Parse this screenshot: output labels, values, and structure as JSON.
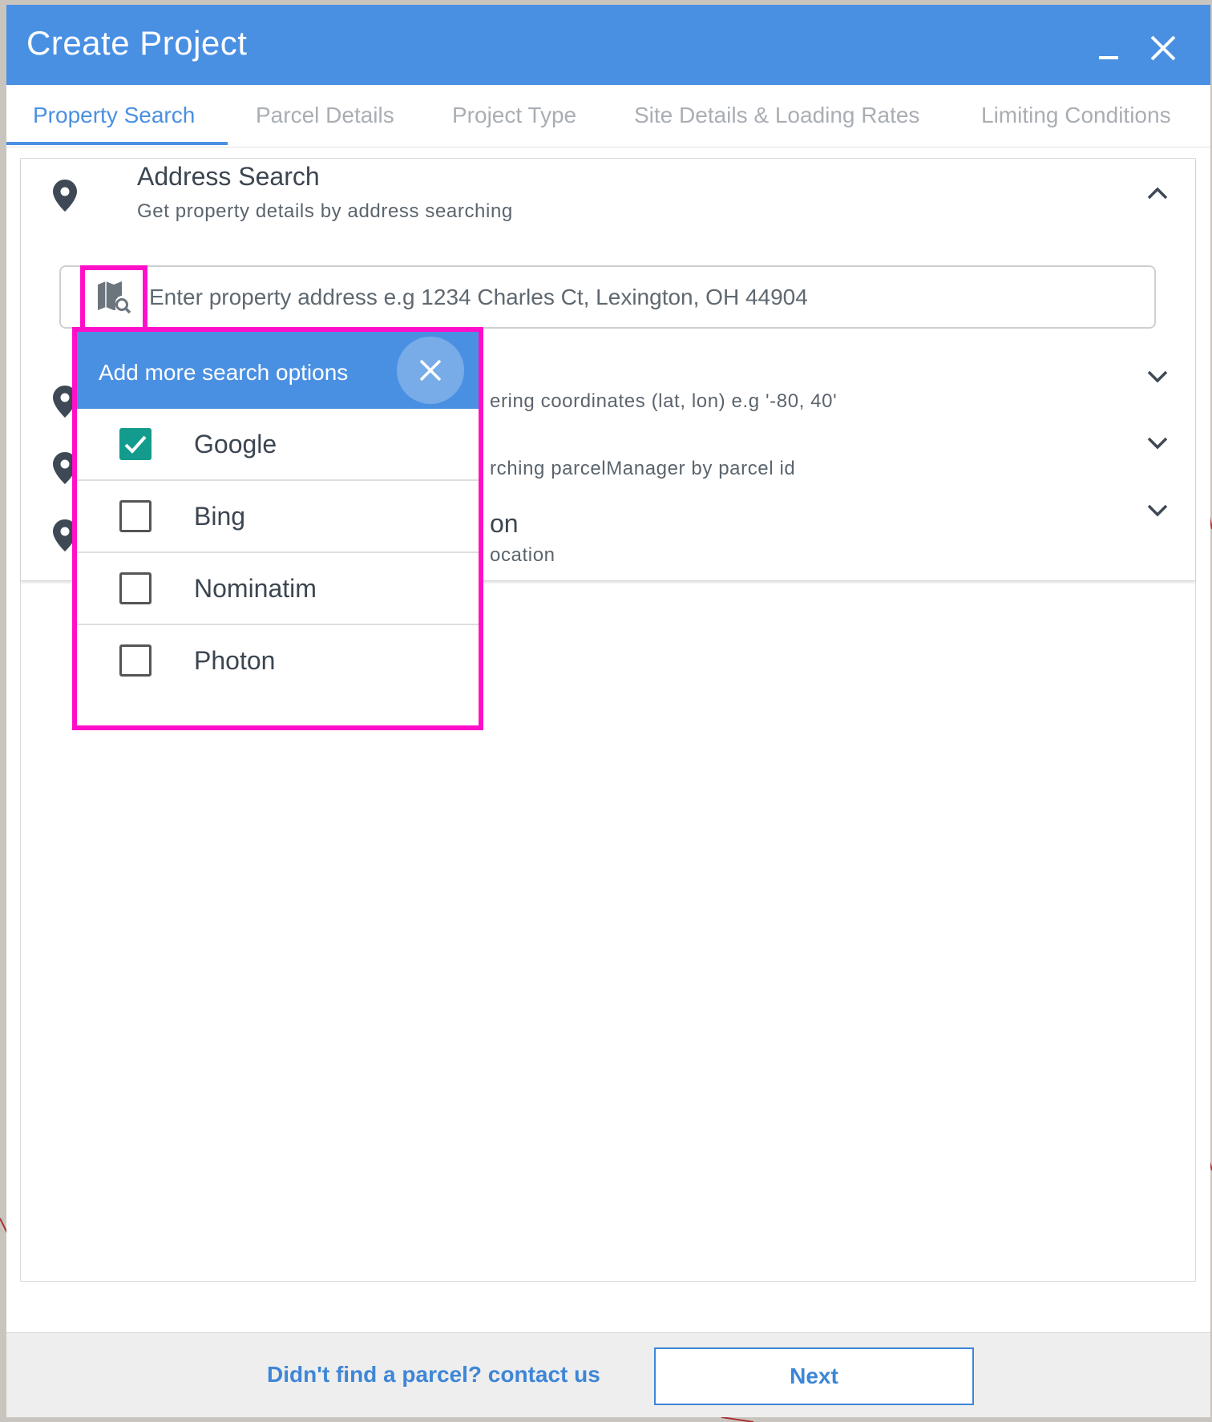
{
  "window": {
    "title": "Create Project"
  },
  "tabs": [
    {
      "label": "Property Search",
      "active": true
    },
    {
      "label": "Parcel Details",
      "active": false
    },
    {
      "label": "Project Type",
      "active": false
    },
    {
      "label": "Site Details & Loading Rates",
      "active": false
    },
    {
      "label": "Limiting Conditions",
      "active": false
    }
  ],
  "address_search": {
    "title": "Address Search",
    "subtitle": "Get property details by address searching",
    "placeholder": "Enter property address e.g 1234 Charles Ct, Lexington, OH 44904"
  },
  "partially_hidden": {
    "coordinates_subtitle_fragment": "ering coordinates (lat, lon) e.g '-80, 40'",
    "parcel_subtitle_fragment": "rching parcelManager by parcel id",
    "location_title_fragment": "on",
    "location_subtitle_fragment": "ocation"
  },
  "popup": {
    "title": "Add more search options",
    "options": [
      {
        "label": "Google",
        "checked": true
      },
      {
        "label": "Bing",
        "checked": false
      },
      {
        "label": "Nominatim",
        "checked": false
      },
      {
        "label": "Photon",
        "checked": false
      }
    ]
  },
  "footer": {
    "contact_link": "Didn't find a parcel? contact us",
    "next_label": "Next"
  },
  "colors": {
    "primary": "#4a90e2",
    "highlight": "#ff10c8",
    "checkbox_checked": "#139b8e"
  }
}
